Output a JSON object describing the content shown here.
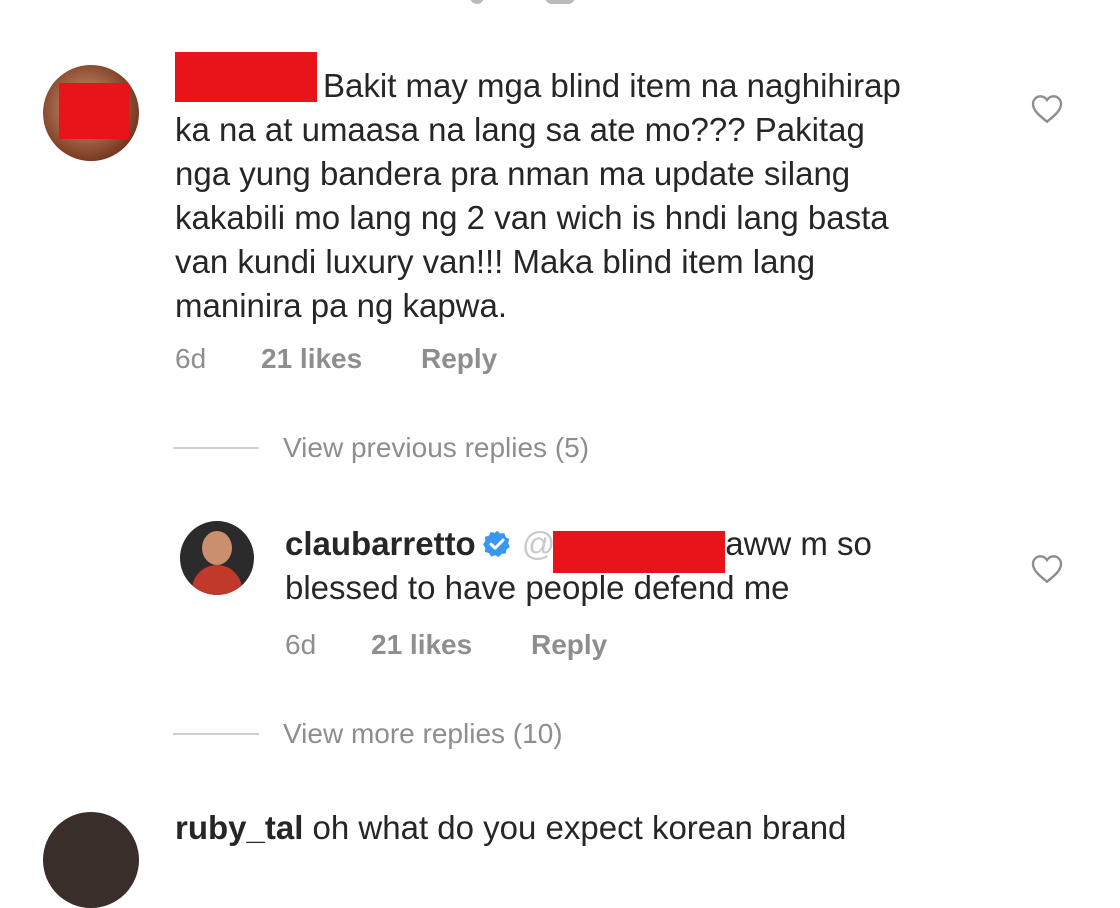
{
  "comment1": {
    "text": "Bakit may mga blind item na naghihirap ka na at umaasa na lang sa ate mo??? Pakitag nga yung bandera pra nman ma update silang kakabili mo lang ng 2 van wich is hndi lang basta van kundi luxury van!!! Maka blind item lang maninira pa ng kapwa.",
    "lines": [
      "Bakit may mga blind item na naghihirap",
      "ka na at umaasa na lang sa ate mo??? Pakitag",
      "nga yung bandera pra nman ma update silang",
      "kakabili mo lang ng 2 van wich is hndi lang basta",
      "van kundi luxury van!!! Maka blind item lang",
      "maninira pa ng kapwa."
    ],
    "time": "6d",
    "likes": "21 likes",
    "reply": "Reply"
  },
  "view_previous": "View previous replies (5)",
  "reply1": {
    "username": "claubarretto",
    "mention": "@",
    "lines": [
      "aww m so",
      "blessed to have people defend me"
    ],
    "time": "6d",
    "likes": "21 likes",
    "reply": "Reply"
  },
  "view_more": "View more replies (10)",
  "comment2": {
    "username": "ruby_tal",
    "text": "oh what do you expect korean brand"
  },
  "icons": {
    "like": "heart-outline-icon",
    "verified": "verified-badge-icon"
  },
  "colors": {
    "redaction": "#e8141a",
    "verified": "#3897f0",
    "muted": "#8e8e8e",
    "text": "#262626"
  }
}
